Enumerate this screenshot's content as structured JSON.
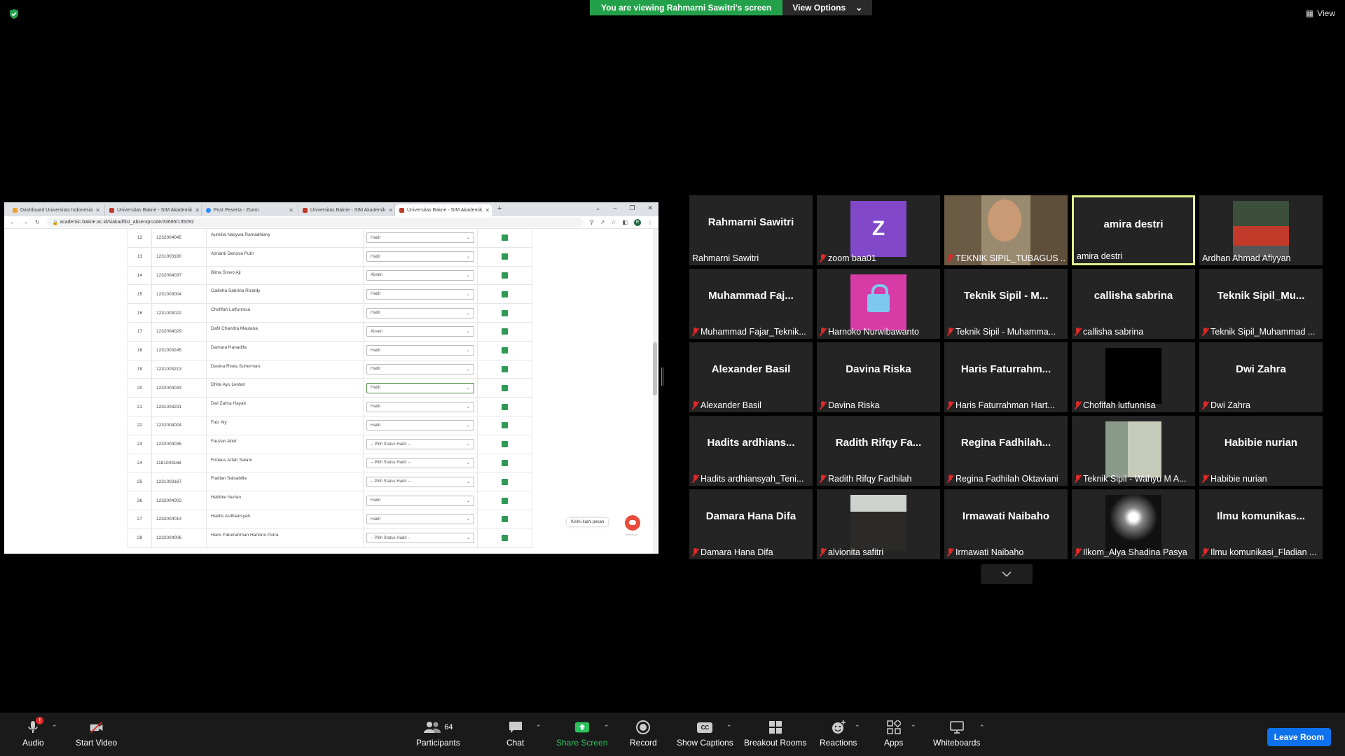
{
  "banner": {
    "viewing": "You are viewing Rahmarni Sawitri's screen",
    "view_options": "View Options",
    "view": "View"
  },
  "browser": {
    "tabs": [
      {
        "label": "Dashboard Universitas Indonesia",
        "icon": "dashboard-favicon"
      },
      {
        "label": "Universitas Bakrie - SIM Akademik",
        "icon": "bakrie-favicon"
      },
      {
        "label": "Post Peserta - Zoom",
        "icon": "zoom-favicon"
      },
      {
        "label": "Universitas Bakrie - SIM Akademik",
        "icon": "bakrie-favicon"
      },
      {
        "label": "Universitas Bakrie - SIM Akademik",
        "icon": "bakrie-favicon"
      }
    ],
    "url": "academic.bakrie.ac.id/siakad/list_absenqrcode/33695/135092",
    "profile": "R"
  },
  "attendance": {
    "rows": [
      {
        "no": "12",
        "nim": "1232004045",
        "name": "Aurellia Nasywa Ramadhiany",
        "status": "Hadir"
      },
      {
        "no": "13",
        "nim": "1231003180",
        "name": "Azrianti Denova Putri",
        "status": "Hadir"
      },
      {
        "no": "14",
        "nim": "1232004037",
        "name": "Bima Siswo Aji",
        "status": "Absen"
      },
      {
        "no": "15",
        "nim": "1231003004",
        "name": "Callisha Sabrina Rizaldy",
        "status": "Hadir"
      },
      {
        "no": "16",
        "nim": "1231003022",
        "name": "Chofifah Lutfunnisa",
        "status": "Hadir"
      },
      {
        "no": "17",
        "nim": "1232004029",
        "name": "Dafit Chandra Maulana",
        "status": "Absen"
      },
      {
        "no": "18",
        "nim": "1231003245",
        "name": "Damara Hanadifa",
        "status": "Hadir"
      },
      {
        "no": "19",
        "nim": "1231003213",
        "name": "Davina Riska Suherman",
        "status": "Hadir"
      },
      {
        "no": "20",
        "nim": "1232004033",
        "name": "Dhita Ayu Lestari",
        "status": "Hadir"
      },
      {
        "no": "21",
        "nim": "1231003231",
        "name": "Dwi Zahra Hayati",
        "status": "Hadir"
      },
      {
        "no": "22",
        "nim": "1232004004",
        "name": "Faiz Aly",
        "status": "Hadir"
      },
      {
        "no": "23",
        "nim": "1232004035",
        "name": "Fauzan Abid",
        "status": "-- Pilih Status Hadir --"
      },
      {
        "no": "24",
        "nim": "1181003168",
        "name": "Firdaus Arfah Salam",
        "status": "-- Pilih Status Hadir --"
      },
      {
        "no": "25",
        "nim": "1231003187",
        "name": "Fladian Salsabilla",
        "status": "-- Pilih Status Hadir --"
      },
      {
        "no": "26",
        "nim": "1232004002",
        "name": "Habibie Nurian",
        "status": "Hadir"
      },
      {
        "no": "27",
        "nim": "1232004014",
        "name": "Hadits Ardhiansyah",
        "status": "Hadir"
      },
      {
        "no": "28",
        "nim": "1232004006",
        "name": "Haris Faturrahman Hartono Putra",
        "status": "-- Pilih Status Hadir --"
      }
    ],
    "chat_widget": "Kirimi kami pesan",
    "chat_credit": "GetButton"
  },
  "participants": [
    {
      "big": "Rahmarni Sawitri",
      "label": "Rahmarni Sawitri",
      "muted": false,
      "thumb": ""
    },
    {
      "big": "",
      "label": "zoom baa01",
      "muted": true,
      "thumb": "z",
      "letter": "Z"
    },
    {
      "big": "",
      "label": "TEKNIK SIPIL_TUBAGUS ...",
      "muted": true,
      "thumb": "video"
    },
    {
      "big": "amira destri",
      "label": "amira destri",
      "muted": false,
      "thumb": "",
      "speaking": true
    },
    {
      "big": "",
      "label": "Ardhan Ahmad Afiyyan",
      "muted": false,
      "thumb": "car"
    },
    {
      "big": "Muhammad  Faj...",
      "label": "Muhammad Fajar_Teknik...",
      "muted": true,
      "thumb": ""
    },
    {
      "big": "",
      "label": "Harnoko Nurwibawanto",
      "muted": true,
      "thumb": "lock"
    },
    {
      "big": "Teknik Sipil - M...",
      "label": "Teknik Sipil - Muhamma...",
      "muted": true,
      "thumb": ""
    },
    {
      "big": "callisha sabrina",
      "label": "callisha sabrina",
      "muted": true,
      "thumb": ""
    },
    {
      "big": "Teknik  Sipil_Mu...",
      "label": "Teknik Sipil_Muhammad ...",
      "muted": true,
      "thumb": ""
    },
    {
      "big": "Alexander Basil",
      "label": "Alexander Basil",
      "muted": true,
      "thumb": ""
    },
    {
      "big": "Davina Riska",
      "label": "Davina Riska",
      "muted": true,
      "thumb": ""
    },
    {
      "big": "Haris  Faturrahm...",
      "label": "Haris Faturrahman Hart...",
      "muted": true,
      "thumb": ""
    },
    {
      "big": "",
      "label": "Chofifah lutfunnisa",
      "muted": true,
      "thumb": "black"
    },
    {
      "big": "Dwi Zahra",
      "label": "Dwi Zahra",
      "muted": true,
      "thumb": ""
    },
    {
      "big": "Hadits  ardhians...",
      "label": "Hadits ardhiansyah_Teni...",
      "muted": true,
      "thumb": ""
    },
    {
      "big": "Radith  Rifqy  Fa...",
      "label": "Radith Rifqy Fadhilah",
      "muted": true,
      "thumb": ""
    },
    {
      "big": "Regina  Fadhilah...",
      "label": "Regina Fadhilah Oktaviani",
      "muted": true,
      "thumb": ""
    },
    {
      "big": "",
      "label": "Teknik Sipil - Wahyu M A...",
      "muted": true,
      "thumb": "tree"
    },
    {
      "big": "Habibie nurian",
      "label": "Habibie nurian",
      "muted": true,
      "thumb": ""
    },
    {
      "big": "Damara Hana Difa",
      "label": "Damara Hana Difa",
      "muted": true,
      "thumb": ""
    },
    {
      "big": "",
      "label": "alvionita safitri",
      "muted": true,
      "thumb": "person"
    },
    {
      "big": "Irmawati Naibaho",
      "label": "Irmawati Naibaho",
      "muted": true,
      "thumb": ""
    },
    {
      "big": "",
      "label": "Ilkom_Alya Shadina Pasya",
      "muted": true,
      "thumb": "night"
    },
    {
      "big": "Ilmu  komunikas...",
      "label": "Ilmu komunikasi_Fladian ...",
      "muted": true,
      "thumb": ""
    }
  ],
  "toolbar": {
    "audio": "Audio",
    "audio_badge": "!",
    "start_video": "Start Video",
    "participants": "Participants",
    "participants_count": "64",
    "chat": "Chat",
    "share_screen": "Share Screen",
    "record": "Record",
    "show_captions": "Show Captions",
    "cc": "CC",
    "breakout_rooms": "Breakout Rooms",
    "reactions": "Reactions",
    "apps": "Apps",
    "whiteboards": "Whiteboards",
    "leave": "Leave Room"
  },
  "colors": {
    "share_green": "#23a14a",
    "leave_blue": "#0e72ed",
    "speaker_border": "#e2ef8c",
    "muted_red": "#e02828"
  }
}
